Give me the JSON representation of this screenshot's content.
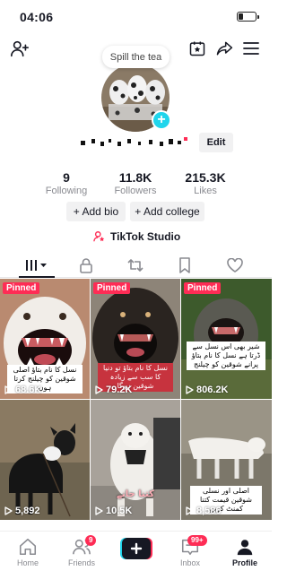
{
  "status_bar": {
    "time": "04:06"
  },
  "profile": {
    "bubble_text": "Spill the tea",
    "edit_label": "Edit",
    "stats": [
      {
        "value": "9",
        "label": "Following"
      },
      {
        "value": "11.8K",
        "label": "Followers"
      },
      {
        "value": "215.3K",
        "label": "Likes"
      }
    ],
    "add_bio_label": "+ Add bio",
    "add_college_label": "+ Add college",
    "studio_label": "TikTok Studio"
  },
  "videos": [
    {
      "pinned": "Pinned",
      "views": "68.6K",
      "caption": "نسل کا نام بتاؤ اصلی شوقین کو چیلنج کرتا ہوں"
    },
    {
      "pinned": "Pinned",
      "views": "79.2K",
      "caption": "نسل کا نام بتاؤ تو دنیا کا سب سے زیادہ شوقین ہوگا"
    },
    {
      "pinned": "Pinned",
      "views": "806.2K",
      "caption": "شیر بھی اس نسل سے ڈرتا ہے نسل کا نام بتاؤ پرانے شوقین کو چیلنج"
    },
    {
      "pinned": "",
      "views": "5,892",
      "caption": ""
    },
    {
      "pinned": "",
      "views": "10.5K",
      "caption": "کتنا جانے"
    },
    {
      "pinned": "",
      "views": "8,586",
      "caption": "اصلی اور نسلی شوقین قیمت کتنا کمنٹ کریں"
    }
  ],
  "bottom_nav": {
    "home": "Home",
    "friends": "Friends",
    "friends_badge": "9",
    "inbox": "Inbox",
    "inbox_badge": "99+",
    "profile": "Profile"
  },
  "colors": {
    "accent": "#fe2c55",
    "cyan": "#20d5ec",
    "text": "#161823",
    "muted": "#8a8b91"
  }
}
